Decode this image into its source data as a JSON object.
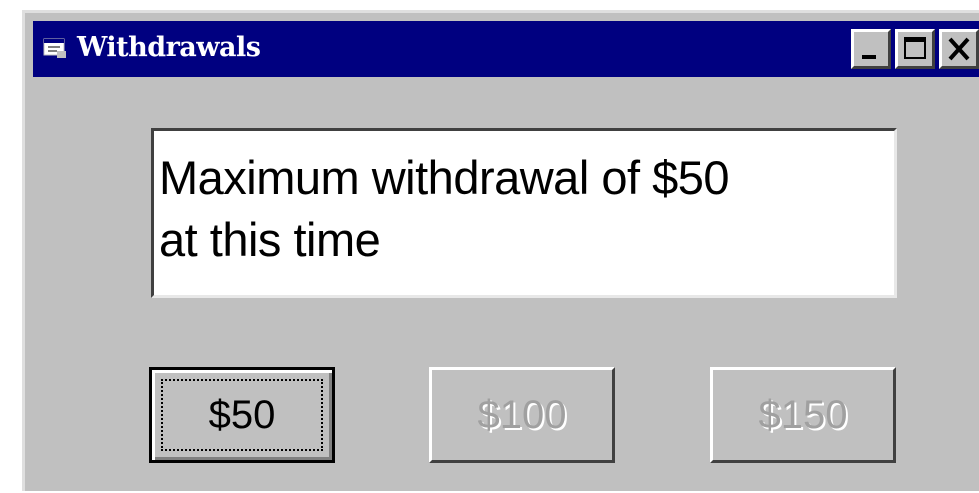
{
  "window": {
    "title": "Withdrawals",
    "icon": "app-window-icon",
    "controls": [
      "minimize-icon",
      "maximize-icon",
      "close-icon"
    ]
  },
  "message": {
    "line1": "Maximum withdrawal of $50",
    "line2": "at this time"
  },
  "buttons": [
    {
      "label": "$50",
      "state": "default"
    },
    {
      "label": "$100",
      "state": "disabled"
    },
    {
      "label": "$150",
      "state": "disabled"
    }
  ],
  "colors": {
    "titlebar": "#000080",
    "face": "#c0c0c0",
    "disabled_text": "#a0a0a0"
  }
}
